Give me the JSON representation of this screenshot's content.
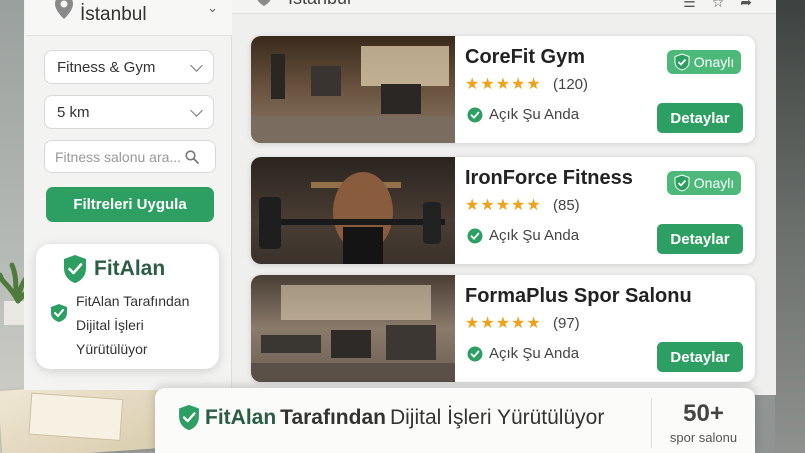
{
  "location": {
    "city": "İstanbul",
    "topbar_city": "İstanbul"
  },
  "filters": {
    "category": "Fitness & Gym",
    "distance": "5 km",
    "search_placeholder": "Fitness salonu ara...",
    "apply_label": "Filtreleri Uygula"
  },
  "brand_card": {
    "name": "FitAlan",
    "description": "FitAlan Tarafından Dijital İşleri Yürütülüyor"
  },
  "gyms": [
    {
      "name": "CoreFit Gym",
      "stars": "★★★★★",
      "reviews": "(120)",
      "status": "Açık Şu Anda",
      "badge": "Onaylı",
      "detail_label": "Detaylar"
    },
    {
      "name": "IronForce Fitness",
      "stars": "★★★★★",
      "reviews": "(85)",
      "status": "Açık Şu Anda",
      "badge": "Onaylı",
      "detail_label": "Detaylar"
    },
    {
      "name": "FormaPlus Spor Salonu",
      "stars": "★★★★★",
      "reviews": "(97)",
      "status": "Açık Şu Anda",
      "detail_label": "Detaylar"
    }
  ],
  "banner": {
    "brand": "FitAlan",
    "title_mid": "Tarafından",
    "title_rest": "Dijital İşleri Yürütülüyor",
    "stat_number": "50+",
    "stat_label": "spor salonu"
  },
  "colors": {
    "accent": "#2e9f62",
    "badge": "#4cb87a",
    "star": "#f0a21a",
    "brand": "#2a5d44"
  }
}
